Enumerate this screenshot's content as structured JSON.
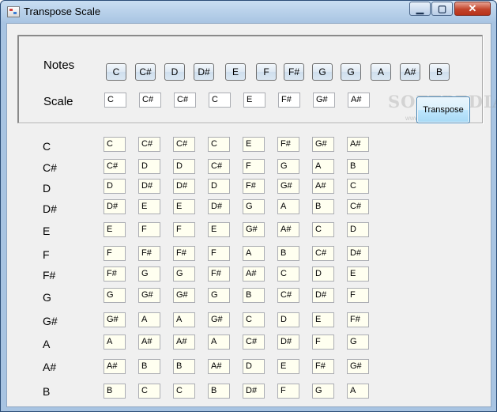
{
  "window": {
    "title": "Transpose Scale",
    "controls": {
      "minimize": "▁",
      "maximize": "▢",
      "close": "✕"
    }
  },
  "labels": {
    "notes": "Notes",
    "scale": "Scale"
  },
  "notes": [
    "C",
    "C#",
    "D",
    "D#",
    "E",
    "F",
    "F#",
    "G",
    "G",
    "A",
    "A#",
    "B"
  ],
  "scale": [
    "C",
    "C#",
    "C#",
    "C",
    "E",
    "F#",
    "G#",
    "A#"
  ],
  "transpose_button": "Transpose",
  "watermark": {
    "text": "SOFTPEDIA",
    "sub": "www.softpedia.com"
  },
  "transpositions": [
    {
      "key": "C",
      "values": [
        "C",
        "C#",
        "C#",
        "C",
        "E",
        "F#",
        "G#",
        "A#"
      ]
    },
    {
      "key": "C#",
      "values": [
        "C#",
        "D",
        "D",
        "C#",
        "F",
        "G",
        "A",
        "B"
      ]
    },
    {
      "key": "D",
      "values": [
        "D",
        "D#",
        "D#",
        "D",
        "F#",
        "G#",
        "A#",
        "C"
      ]
    },
    {
      "key": "D#",
      "values": [
        "D#",
        "E",
        "E",
        "D#",
        "G",
        "A",
        "B",
        "C#"
      ]
    },
    {
      "key": "E",
      "values": [
        "E",
        "F",
        "F",
        "E",
        "G#",
        "A#",
        "C",
        "D"
      ]
    },
    {
      "key": "F",
      "values": [
        "F",
        "F#",
        "F#",
        "F",
        "A",
        "B",
        "C#",
        "D#"
      ]
    },
    {
      "key": "F#",
      "values": [
        "F#",
        "G",
        "G",
        "F#",
        "A#",
        "C",
        "D",
        "E"
      ]
    },
    {
      "key": "G",
      "values": [
        "G",
        "G#",
        "G#",
        "G",
        "B",
        "C#",
        "D#",
        "F"
      ]
    },
    {
      "key": "G#",
      "values": [
        "G#",
        "A",
        "A",
        "G#",
        "C",
        "D",
        "E",
        "F#"
      ]
    },
    {
      "key": "A",
      "values": [
        "A",
        "A#",
        "A#",
        "A",
        "C#",
        "D#",
        "F",
        "G"
      ]
    },
    {
      "key": "A#",
      "values": [
        "A#",
        "B",
        "B",
        "A#",
        "D",
        "E",
        "F#",
        "G#"
      ]
    },
    {
      "key": "B",
      "values": [
        "B",
        "C",
        "C",
        "B",
        "D#",
        "F",
        "G",
        "A"
      ]
    }
  ]
}
